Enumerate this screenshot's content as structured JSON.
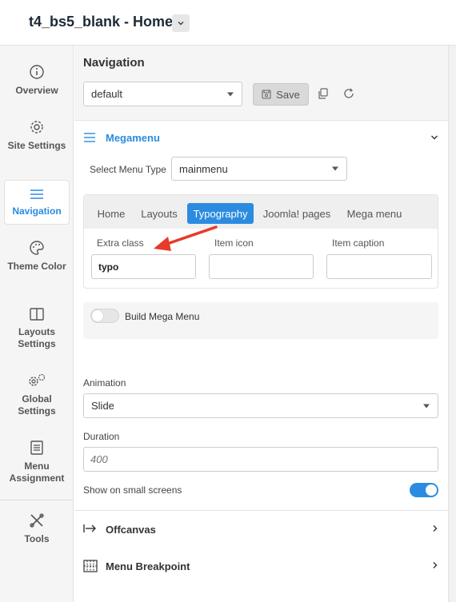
{
  "header": {
    "title": "t4_bs5_blank - Home"
  },
  "sidebar": {
    "items": [
      {
        "label": "Overview",
        "icon": "info-icon"
      },
      {
        "label": "Site Settings",
        "icon": "gear-icon"
      },
      {
        "label": "Navigation",
        "icon": "menu-icon"
      },
      {
        "label": "Theme Color",
        "icon": "palette-icon"
      },
      {
        "label": "Layouts Settings",
        "icon": "columns-icon"
      },
      {
        "label": "Global Settings",
        "icon": "gears-icon"
      },
      {
        "label": "Menu Assignment",
        "icon": "list-icon"
      },
      {
        "label": "Tools",
        "icon": "tools-icon"
      }
    ]
  },
  "nav": {
    "title": "Navigation",
    "preset": "default",
    "save_label": "Save"
  },
  "megamenu": {
    "title": "Megamenu",
    "select_menu_type_label": "Select Menu Type",
    "select_menu_type_value": "mainmenu",
    "tabs": [
      "Home",
      "Layouts",
      "Typography",
      "Joomla! pages",
      "Mega menu"
    ],
    "active_tab": "Typography",
    "extra_class_label": "Extra class",
    "extra_class_value": "typo",
    "item_icon_label": "Item icon",
    "item_caption_label": "Item caption",
    "build_mega_menu_label": "Build Mega Menu",
    "build_mega_menu_on": false,
    "animation_label": "Animation",
    "animation_value": "Slide",
    "duration_label": "Duration",
    "duration_placeholder": "400",
    "small_screens_label": "Show on small screens",
    "small_screens_on": true
  },
  "sections": {
    "offcanvas": "Offcanvas",
    "menu_breakpoint": "Menu Breakpoint"
  },
  "colors": {
    "accent": "#2b8be0",
    "annotation_arrow": "#e8392a"
  }
}
